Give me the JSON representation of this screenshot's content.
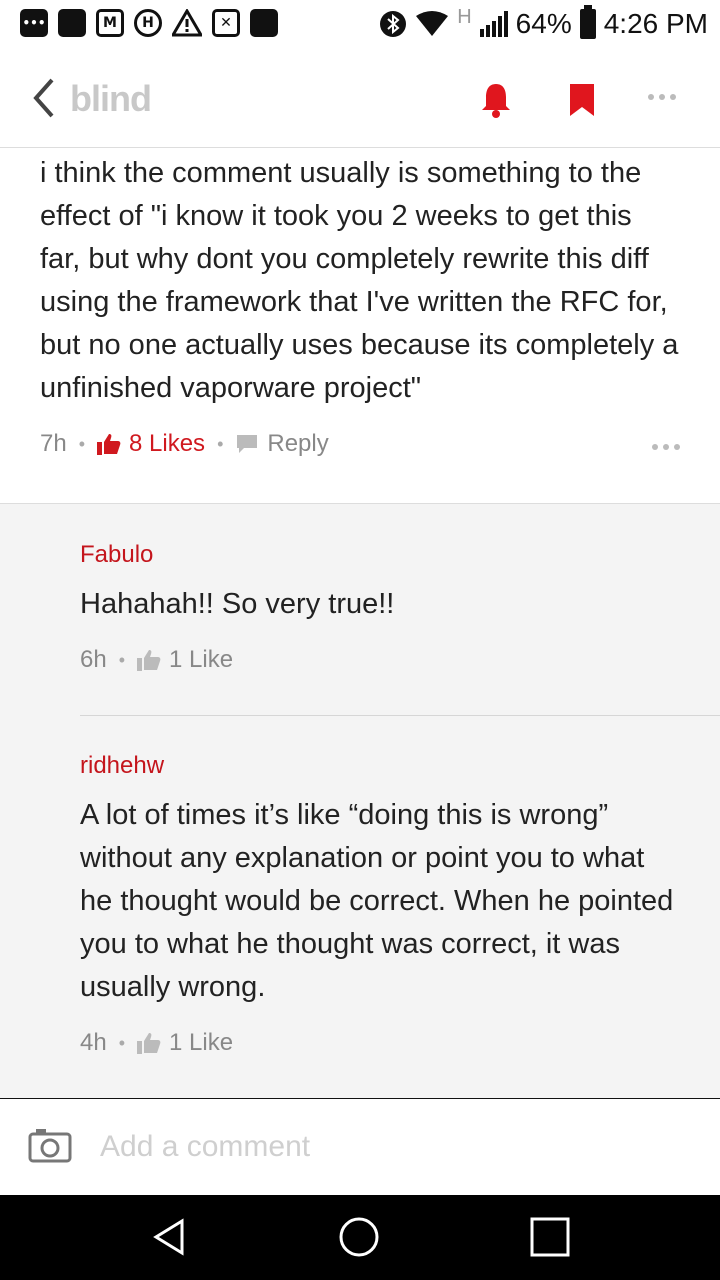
{
  "status_bar": {
    "battery": "64%",
    "time": "4:26 PM",
    "network": "H",
    "notification_icons": [
      "more-icon",
      "square-icon",
      "gmail-icon",
      "hangouts-icon",
      "warning-icon",
      "close-box-icon",
      "message-icon"
    ]
  },
  "header": {
    "brand": "blind",
    "accent_color": "#e0161e"
  },
  "main_comment": {
    "text": "i think the comment usually is something to the effect of  \"i know it took you 2 weeks to get this far, but why dont you completely rewrite this diff using the framework that I've written the RFC for, but no one actually uses  because its completely a unfinished vaporware project\"",
    "time": "7h",
    "likes": "8 Likes",
    "reply_label": "Reply"
  },
  "replies": [
    {
      "author": "Fabulo",
      "text": "Hahahah!! So very true!!",
      "time": "6h",
      "likes": "1 Like"
    },
    {
      "author": "ridhehw",
      "text": "A lot of times it’s like “doing this is wrong” without any explanation or point you to what he thought would be correct. When he pointed you to what he thought was correct, it was usually wrong.",
      "time": "4h",
      "likes": "1 Like"
    }
  ],
  "composer": {
    "placeholder": "Add a comment"
  }
}
